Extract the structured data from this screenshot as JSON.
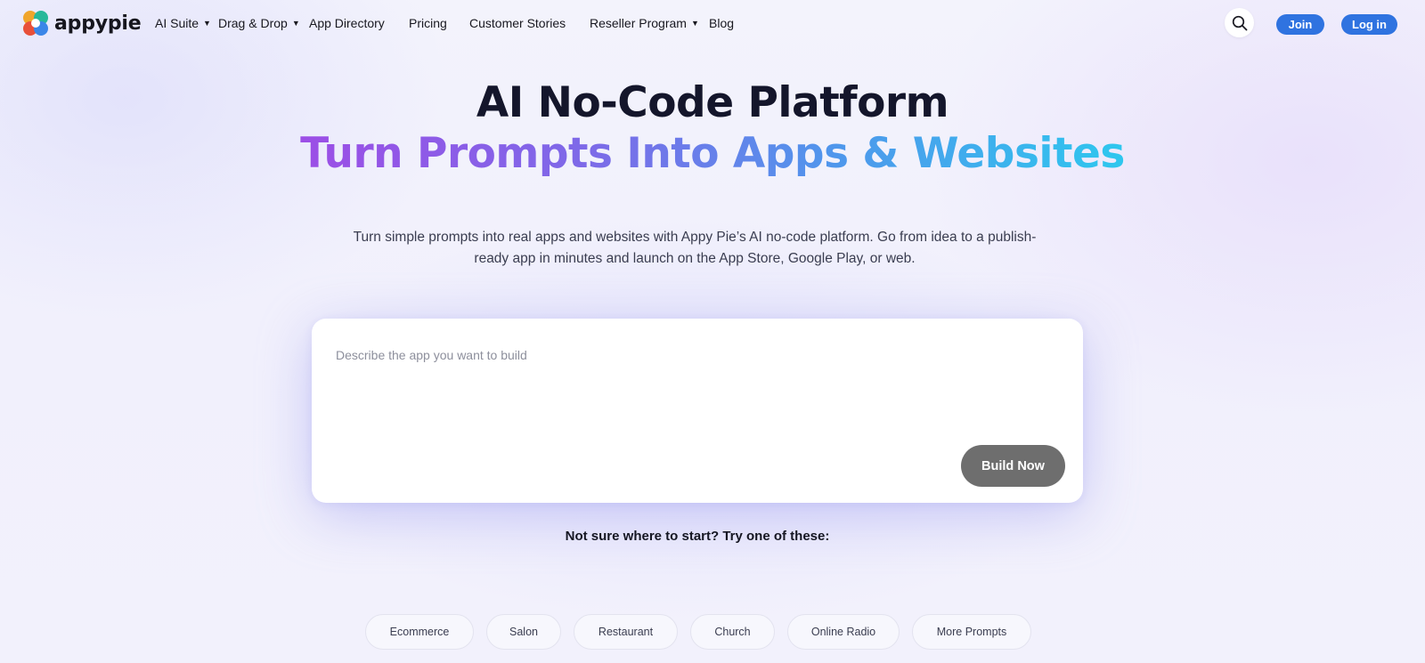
{
  "brand": {
    "name": "appypie"
  },
  "nav": {
    "items": [
      {
        "label": "AI Suite",
        "has_dropdown": true
      },
      {
        "label": "Drag & Drop",
        "has_dropdown": true
      },
      {
        "label": "App Directory",
        "has_dropdown": false
      },
      {
        "label": "Pricing",
        "has_dropdown": false
      },
      {
        "label": "Customer Stories",
        "has_dropdown": false
      },
      {
        "label": "Reseller Program",
        "has_dropdown": true
      },
      {
        "label": "Blog",
        "has_dropdown": false
      }
    ],
    "join_label": "Join",
    "login_label": "Log in",
    "search_icon": "search-icon"
  },
  "hero": {
    "title": "AI No-Code Platform",
    "subtitle": "Turn Prompts Into Apps & Websites",
    "description": "Turn simple prompts into real apps and websites with Appy Pie’s AI no-code platform. Go from idea to a publish-ready app in minutes and launch on the App Store, Google Play, or web."
  },
  "prompt": {
    "placeholder": "Describe the app you want to build",
    "value": "",
    "build_label": "Build Now"
  },
  "suggestions": {
    "intro": "Not sure where to start? Try one of these:",
    "chips": [
      "Ecommerce",
      "Salon",
      "Restaurant",
      "Church",
      "Online Radio",
      "More Prompts"
    ]
  },
  "colors": {
    "accent": "#2f73e0",
    "gradient_start": "#9c4ee6",
    "gradient_end": "#2ec7ee",
    "build_button": "#6e6e6e"
  }
}
